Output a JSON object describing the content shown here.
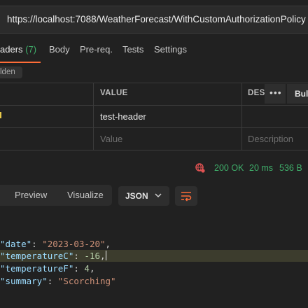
{
  "request": {
    "url": "https://localhost:7088/WeatherForecast/WithCustomAuthorizationPolicy"
  },
  "tabs": [
    {
      "label": "aders",
      "count": "(7)"
    },
    {
      "label": "Body"
    },
    {
      "label": "Pre-req."
    },
    {
      "label": "Tests"
    },
    {
      "label": "Settings"
    }
  ],
  "hidden_chip": "lden",
  "headers_table": {
    "columns": {
      "value": "VALUE",
      "description": "DES"
    },
    "more_label": "•••",
    "bulk_label": "Bul",
    "rows": [
      {
        "value": "test-header",
        "description": ""
      }
    ],
    "placeholders": {
      "value": "Value",
      "description": "Description"
    }
  },
  "response": {
    "status": "200 OK",
    "time": "20 ms",
    "size": "536 B",
    "view_modes": [
      "Preview",
      "Visualize"
    ],
    "format": "JSON",
    "body_lines": [
      {
        "key": "\"date\"",
        "value": "\"2023-03-20\"",
        "value_type": "string",
        "suffix": ","
      },
      {
        "key": "\"temperatureC\"",
        "value": "-16",
        "value_type": "number",
        "suffix": ","
      },
      {
        "key": "\"temperatureF\"",
        "value": "4",
        "value_type": "number",
        "suffix": ","
      },
      {
        "key": "\"summary\"",
        "value": "\"Scorching\"",
        "value_type": "string",
        "suffix": ""
      }
    ]
  },
  "colors": {
    "accent": "#ff6c37",
    "success": "#3fae6a",
    "status_icon": "#e05252"
  },
  "icons": [
    "globe-icon",
    "chevron-down-icon",
    "wrap-lines-icon"
  ]
}
